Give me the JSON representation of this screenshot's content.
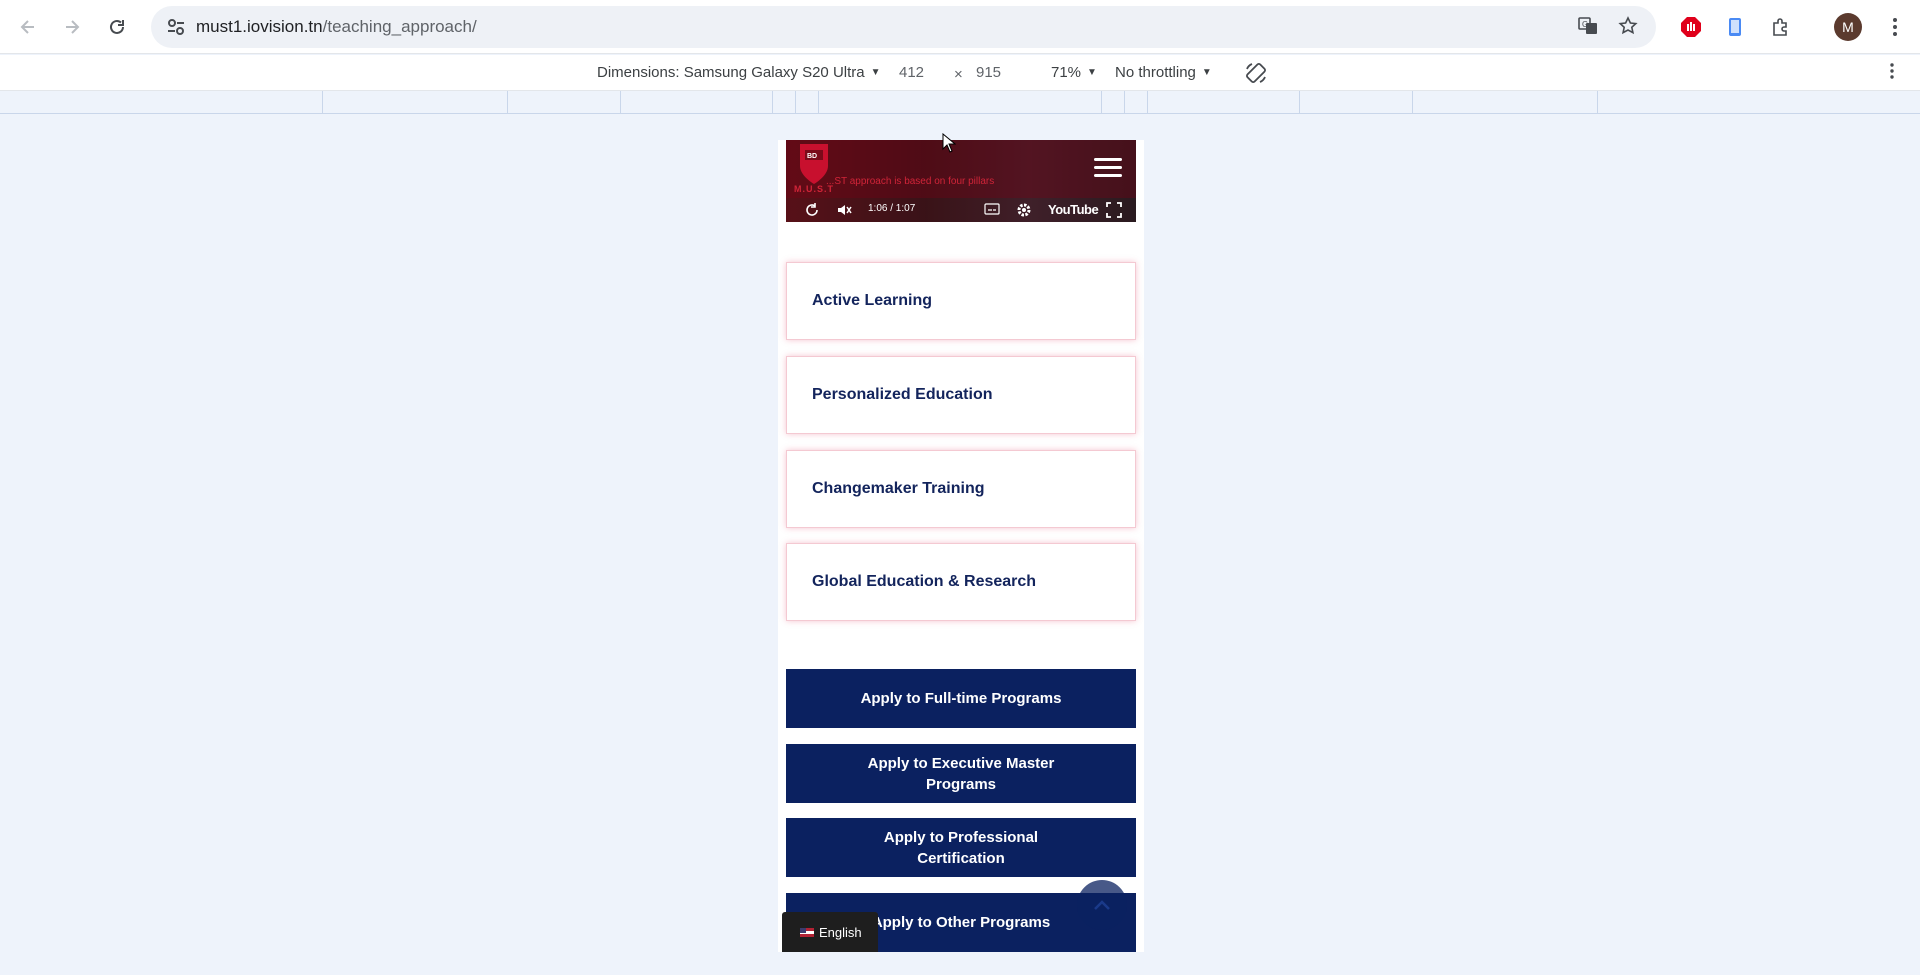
{
  "browser": {
    "url_host": "must1.iovision.tn",
    "url_path": "/teaching_approach/",
    "avatar_letter": "M"
  },
  "devtools": {
    "dimensions_label": "Dimensions: Samsung Galaxy S20 Ultra",
    "width": "412",
    "times": "×",
    "height": "915",
    "zoom": "71%",
    "throttling": "No throttling"
  },
  "video": {
    "logo_text": "M.U.S.T",
    "caption": "...ST approach is based on four pillars",
    "time": "1:06 / 1:07",
    "youtube_label": "YouTube"
  },
  "pillars": [
    {
      "label": "Active Learning"
    },
    {
      "label": "Personalized Education"
    },
    {
      "label": "Changemaker Training"
    },
    {
      "label": "Global Education & Research"
    }
  ],
  "apply_buttons": [
    {
      "label": "Apply to Full-time Programs"
    },
    {
      "label": "Apply to Executive Master Programs"
    },
    {
      "label": "Apply to Professional Certification"
    },
    {
      "label": "Apply to Other Programs"
    }
  ],
  "language": {
    "label": "English"
  },
  "colors": {
    "brand_navy": "#0b2160",
    "card_text": "#13245c",
    "card_glow": "#f4c9d2"
  }
}
